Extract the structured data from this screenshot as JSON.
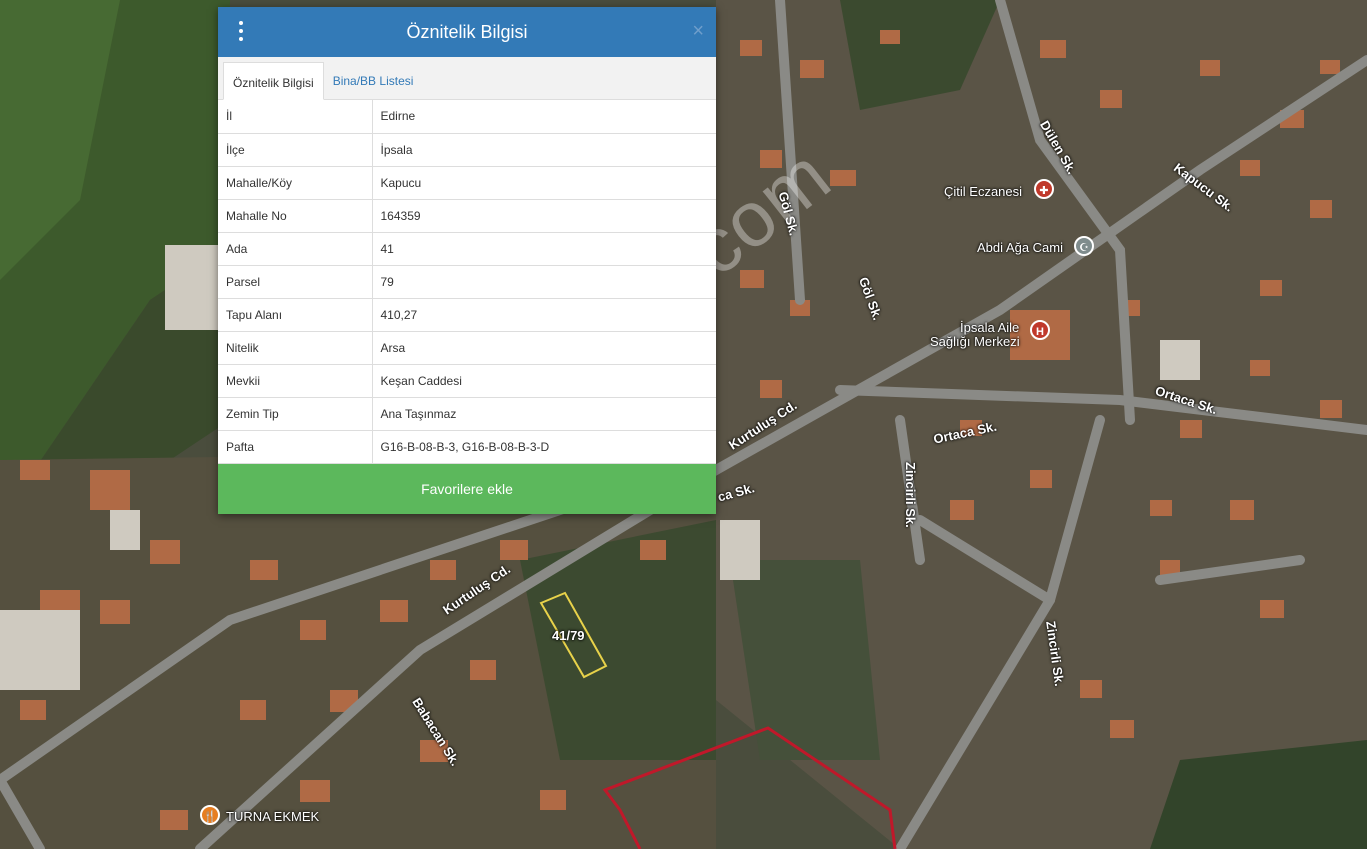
{
  "panel": {
    "title": "Öznitelik Bilgisi",
    "close_label": "×",
    "tabs": [
      {
        "label": "Öznitelik Bilgisi",
        "active": true
      },
      {
        "label": "Bina/BB Listesi",
        "active": false
      }
    ],
    "rows": [
      {
        "key": "İl",
        "value": "Edirne"
      },
      {
        "key": "İlçe",
        "value": "İpsala"
      },
      {
        "key": "Mahalle/Köy",
        "value": "Kapucu"
      },
      {
        "key": "Mahalle No",
        "value": "164359"
      },
      {
        "key": "Ada",
        "value": "41"
      },
      {
        "key": "Parsel",
        "value": "79"
      },
      {
        "key": "Tapu Alanı",
        "value": "410,27"
      },
      {
        "key": "Nitelik",
        "value": "Arsa"
      },
      {
        "key": "Mevkii",
        "value": "Keşan Caddesi"
      },
      {
        "key": "Zemin Tip",
        "value": "Ana Taşınmaz"
      },
      {
        "key": "Pafta",
        "value": "G16-B-08-B-3, G16-B-08-B-3-D"
      }
    ],
    "favorite_button": "Favorilere ekle"
  },
  "map": {
    "streets": {
      "kurtulus_1": "Kurtuluş Cd.",
      "kurtulus_2": "Kurtuluş Cd.",
      "dulen": "Dülen Sk.",
      "kapucu": "Kapucu Sk.",
      "gol_1": "Göl Sk.",
      "gol_2": "Göl Sk.",
      "ortaca_1": "Ortaca Sk.",
      "ortaca_2": "Ortaca Sk.",
      "zincirli_1": "Zincirli Sk.",
      "zincirli_2": "Zincirli Sk.",
      "babacan": "Babacan Sk.",
      "kesan_partial": "ca Sk."
    },
    "pois": {
      "eczane": "Çitil Eczanesi",
      "cami": "Abdi Ağa Cami",
      "saglik_1": "İpsala Aile",
      "saglik_2": "Sağlığı Merkezi",
      "ekmek": "TURNA EKMEK"
    },
    "parcel_label": "41/79",
    "watermark": "emlakjet.com",
    "colors": {
      "header": "#337ab7",
      "button": "#5cb85c",
      "parcel": "#e8d24a",
      "boundary": "#c0182a"
    }
  }
}
